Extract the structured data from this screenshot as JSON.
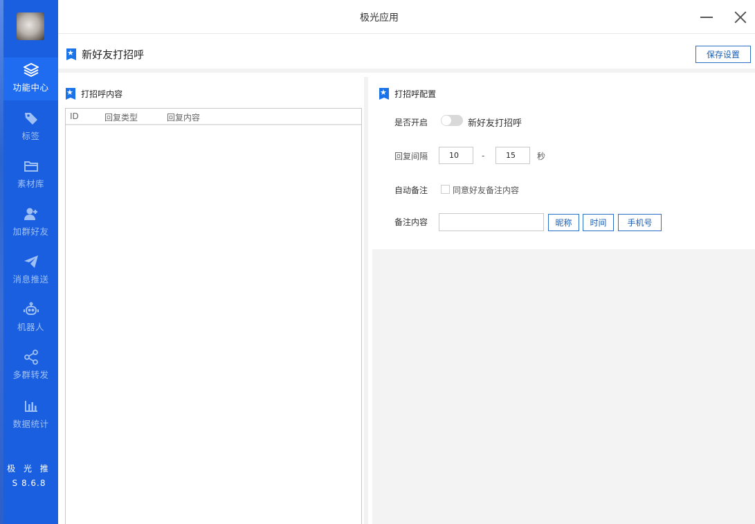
{
  "app": {
    "title": "极光应用",
    "brand": "极 光 推",
    "version": "S 8.6.8"
  },
  "sidebar": {
    "items": [
      {
        "label": "功能中心",
        "icon": "layers-icon",
        "active": true
      },
      {
        "label": "标签",
        "icon": "tag-icon",
        "active": false
      },
      {
        "label": "素材库",
        "icon": "folder-icon",
        "active": false
      },
      {
        "label": "加群好友",
        "icon": "add-user-icon",
        "active": false
      },
      {
        "label": "消息推送",
        "icon": "send-icon",
        "active": false
      },
      {
        "label": "机器人",
        "icon": "robot-icon",
        "active": false
      },
      {
        "label": "多群转发",
        "icon": "share-icon",
        "active": false
      },
      {
        "label": "数据统计",
        "icon": "bar-chart-icon",
        "active": false
      }
    ]
  },
  "page": {
    "title": "新好友打招呼",
    "save_label": "保存设置"
  },
  "left": {
    "title": "打招呼内容",
    "columns": [
      "ID",
      "回复类型",
      "回复内容"
    ],
    "rows": []
  },
  "right": {
    "title": "打招呼配置",
    "enable": {
      "label": "是否开启",
      "toggle_label": "新好友打招呼",
      "on": false
    },
    "interval": {
      "label": "回复间隔",
      "min": "10",
      "max": "15",
      "separator": "-",
      "unit": "秒"
    },
    "auto_remark": {
      "label": "自动备注",
      "checkbox_label": "同意好友备注内容",
      "checked": false
    },
    "remark": {
      "label": "备注内容",
      "value": "",
      "buttons": [
        "昵称",
        "时间",
        "手机号"
      ]
    }
  },
  "colors": {
    "sidebar": "#1a5fe0",
    "sidebar_active": "#1f6cf0",
    "accent": "#1a73e8",
    "button_border": "#2a6fc7"
  }
}
